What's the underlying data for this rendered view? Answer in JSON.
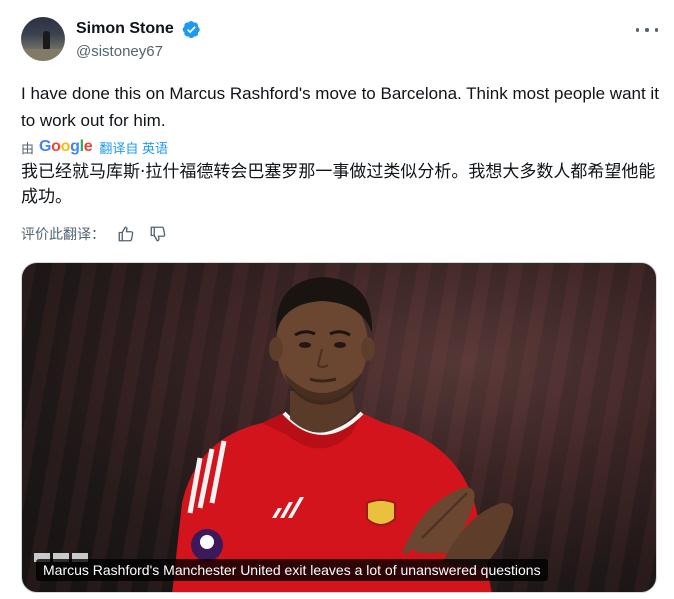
{
  "author": {
    "name": "Simon Stone",
    "handle": "@sistoney67",
    "verified": true
  },
  "tweet": {
    "text": "I have done this on Marcus Rashford's move to Barcelona. Think most people want it to work out for him."
  },
  "translation": {
    "by_label": "由",
    "provider": "Google",
    "link_label": "翻译自 英语",
    "text": "我已经就马库斯·拉什福德转会巴塞罗那一事做过类似分析。我想大多数人都希望他能成功。",
    "rate_label": "评价此翻译："
  },
  "media": {
    "caption": "Marcus Rashford's Manchester United exit leaves a lot of unanswered questions"
  },
  "colors": {
    "link": "#1d9bf0",
    "secondary_text": "#536471",
    "jersey_red": "#d3141c"
  },
  "icons": [
    "verified-badge-icon",
    "more-options-icon",
    "thumbs-up-icon",
    "thumbs-down-icon"
  ]
}
